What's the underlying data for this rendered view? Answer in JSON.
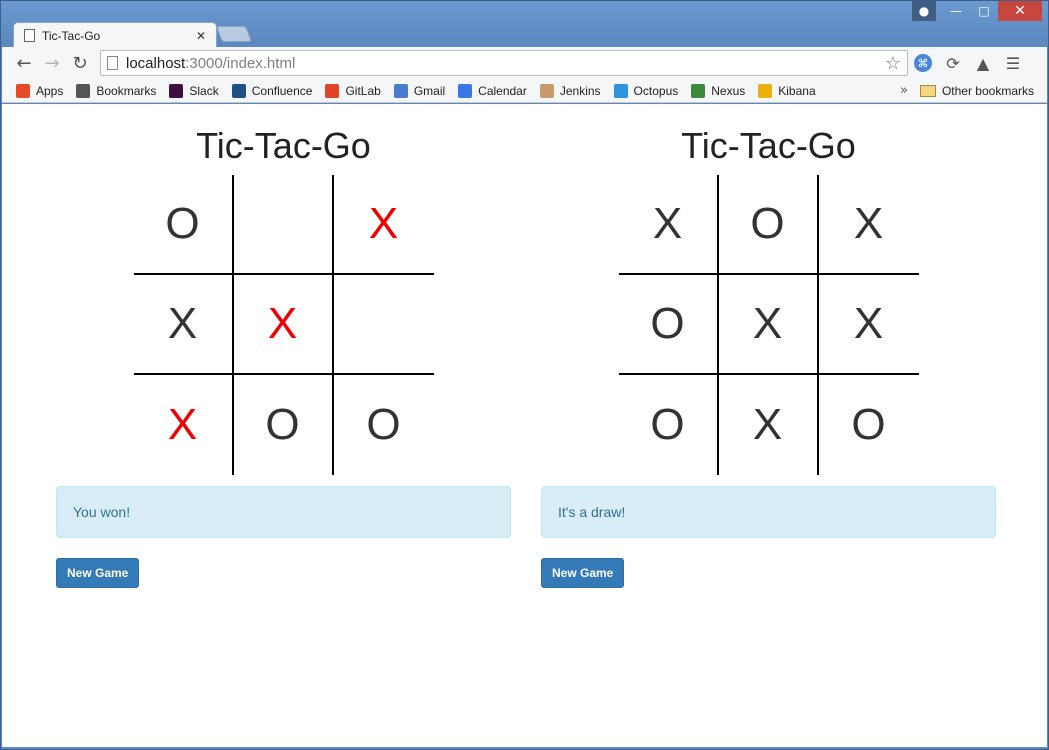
{
  "browser": {
    "tab_title": "Tic-Tac-Go",
    "url_host": "localhost",
    "url_path": ":3000/index.html",
    "bookmarks": [
      {
        "label": "Apps",
        "color": "#e34c26"
      },
      {
        "label": "Bookmarks",
        "color": "#555555"
      },
      {
        "label": "Slack",
        "color": "#3f0f3f"
      },
      {
        "label": "Confluence",
        "color": "#205081"
      },
      {
        "label": "GitLab",
        "color": "#e24329"
      },
      {
        "label": "Gmail",
        "color": "#4a7bd0"
      },
      {
        "label": "Calendar",
        "color": "#3b78e7"
      },
      {
        "label": "Jenkins",
        "color": "#c89b6d"
      },
      {
        "label": "Octopus",
        "color": "#2f93e0"
      },
      {
        "label": "Nexus",
        "color": "#3a8a3a"
      },
      {
        "label": "Kibana",
        "color": "#e8b10e"
      }
    ],
    "other_bookmarks": "Other bookmarks"
  },
  "games": [
    {
      "title": "Tic-Tac-Go",
      "board": [
        "O",
        "",
        "X",
        "X",
        "X",
        "",
        "X",
        "O",
        "O"
      ],
      "winning_cells": [
        2,
        4,
        6
      ],
      "status": "You won!",
      "button": "New Game"
    },
    {
      "title": "Tic-Tac-Go",
      "board": [
        "X",
        "O",
        "X",
        "O",
        "X",
        "X",
        "O",
        "X",
        "O"
      ],
      "winning_cells": [],
      "status": "It's a draw!",
      "button": "New Game"
    }
  ],
  "colors": {
    "win_mark": "#f00000",
    "alert_bg": "#d9edf7",
    "button_bg": "#337ab7"
  }
}
